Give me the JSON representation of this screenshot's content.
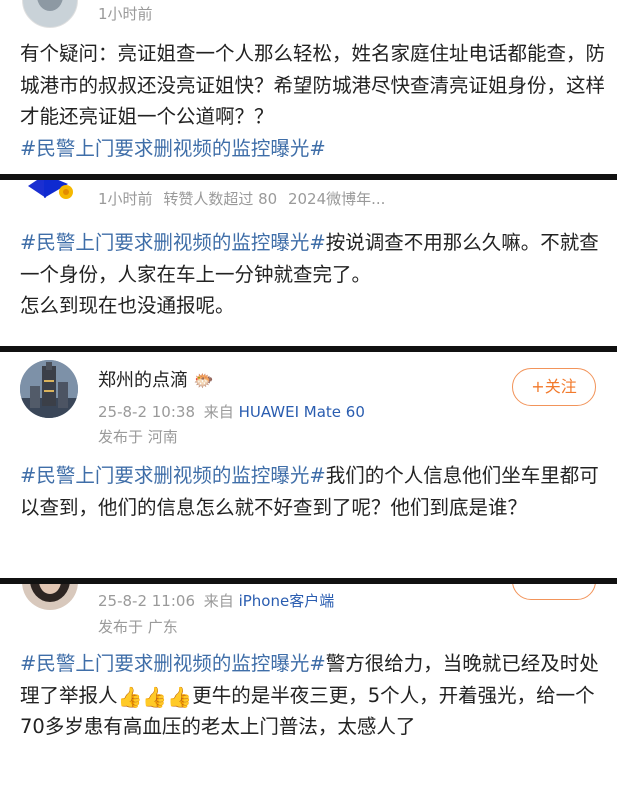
{
  "posts": [
    {
      "meta_time": "1小时前",
      "text_1": "有个疑问：亮证姐查一个人那么轻松，姓名家庭住址电话都能查，防城港市的叔叔还没亮证姐快？希望防城港尽快查清亮证姐身份，这样才能还亮证姐一个公道啊？？",
      "hashtag": "#民警上门要求删视频的监控曝光#"
    },
    {
      "meta_time": "1小时前",
      "meta_extra": "转赞人数超过 80",
      "meta_member": "2024微博年...",
      "hashtag": "#民警上门要求删视频的监控曝光#",
      "text_1": "按说调查不用那么久嘛。不就查一个身份，人家在车上一分钟就查完了。",
      "text_2": "怎么到现在也没通报呢。"
    },
    {
      "username": "郑州的点滴",
      "follow_label": "+关注",
      "meta_time": "25-8-2 10:38",
      "meta_from": "来自",
      "meta_device": "HUAWEI Mate 60",
      "location": "发布于 河南",
      "hashtag": "#民警上门要求删视频的监控曝光#",
      "text_1": "我们的个人信息他们坐车里都可以查到，他们的信息怎么就不好查到了呢？他们到底是谁？"
    },
    {
      "meta_time": "25-8-2 11:06",
      "meta_from": "来自",
      "meta_device": "iPhone客户端",
      "location": "发布于 广东",
      "hashtag": "#民警上门要求删视频的监控曝光#",
      "text_1": "警方很给力，当晚就已经及时处理了举报人",
      "thumbs": "👍👍👍",
      "text_2": "更牛的是半夜三更，5个人，开着强光，给一个70多岁患有高血压的老太上门普法，太感人了"
    }
  ],
  "colors": {
    "hashtag": "#3f6ea8",
    "meta": "#9a9a9a",
    "follow": "#f27a2c",
    "device": "#2a5db0"
  }
}
